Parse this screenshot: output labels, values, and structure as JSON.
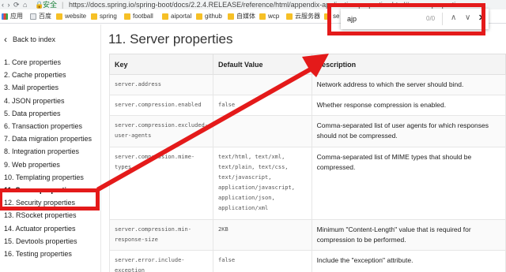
{
  "browser": {
    "nav_glyphs": "‹ › ⟳ ⌂",
    "lock_icon": "🔒",
    "secure_label": "安全",
    "separator": "|",
    "url": "https://docs.spring.io/spring-boot/docs/2.2.4.RELEASE/reference/html/appendix-application-properties.html#server-properties"
  },
  "bookmarks": [
    {
      "label": "应用",
      "icon": "apps-icon"
    },
    {
      "label": "百度",
      "icon": "bookmark-icon"
    },
    {
      "label": "website",
      "icon": "folder-icon"
    },
    {
      "label": "spring",
      "icon": "folder-icon"
    },
    {
      "label": "football",
      "icon": "folder-icon"
    },
    {
      "label": "aiportal",
      "icon": "folder-icon"
    },
    {
      "label": "github",
      "icon": "folder-icon"
    },
    {
      "label": "自媒体",
      "icon": "folder-icon"
    },
    {
      "label": "wcp",
      "icon": "folder-icon"
    },
    {
      "label": "云服务器",
      "icon": "folder-icon"
    },
    {
      "label": "se",
      "icon": "folder-icon"
    }
  ],
  "sidebar": {
    "back_label": "Back to index",
    "items": [
      "1. Core properties",
      "2. Cache properties",
      "3. Mail properties",
      "4. JSON properties",
      "5. Data properties",
      "6. Transaction properties",
      "7. Data migration properties",
      "8. Integration properties",
      "9. Web properties",
      "10. Templating properties",
      "11. Server properties",
      "12. Security properties",
      "13. RSocket properties",
      "14. Actuator properties",
      "15. Devtools properties",
      "16. Testing properties"
    ],
    "active_index": 10
  },
  "main": {
    "title": "11. Server properties",
    "columns": [
      "Key",
      "Default Value",
      "Description"
    ],
    "rows": [
      {
        "key": "server.address",
        "default": "",
        "description": "Network address to which the server should bind."
      },
      {
        "key": "server.compression.enabled",
        "default": "false",
        "description": "Whether response compression is enabled."
      },
      {
        "key": "server.compression.excluded-user-agents",
        "default": "",
        "description": "Comma-separated list of user agents for which responses should not be compressed."
      },
      {
        "key": "server.compression.mime-types",
        "default": "text/html, text/xml, text/plain, text/css, text/javascript, application/javascript, application/json, application/xml",
        "description": "Comma-separated list of MIME types that should be compressed."
      },
      {
        "key": "server.compression.min-response-size",
        "default": "2KB",
        "description": "Minimum \"Content-Length\" value that is required for compression to be performed."
      },
      {
        "key": "server.error.include-exception",
        "default": "false",
        "description": "Include the \"exception\" attribute."
      }
    ]
  },
  "findbar": {
    "query": "ajp",
    "count": "0/0",
    "up_glyph": "∧",
    "down_glyph": "∨",
    "close_glyph": "✕"
  },
  "colors": {
    "annotation": "#e41a1a"
  }
}
